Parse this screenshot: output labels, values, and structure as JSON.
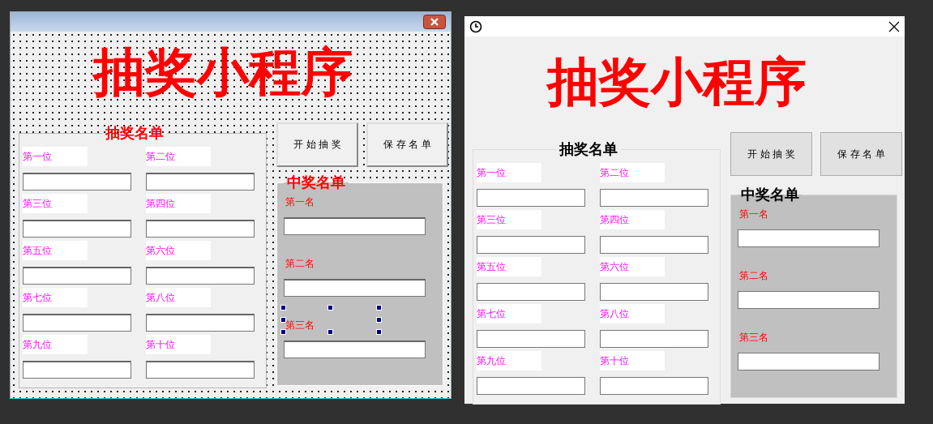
{
  "windows": [
    {
      "kind": "designer",
      "heading": "抽奖小程序",
      "list_frame": {
        "legend": "抽奖名单",
        "labels": [
          "第一位",
          "第二位",
          "第三位",
          "第四位",
          "第五位",
          "第六位",
          "第七位",
          "第八位",
          "第九位",
          "第十位"
        ]
      },
      "buttons": [
        "开 始 抽 奖",
        "保 存 名 单"
      ],
      "winners_frame": {
        "legend": "中奖名单",
        "labels": [
          {
            "text": "第一名",
            "selected": false
          },
          {
            "text": "第二名",
            "selected": false
          },
          {
            "text": "第三名",
            "selected": true
          }
        ]
      }
    },
    {
      "kind": "runtime",
      "heading": "抽奖小程序",
      "list_frame": {
        "legend": "抽奖名单",
        "labels": [
          "第一位",
          "第二位",
          "第三位",
          "第四位",
          "第五位",
          "第六位",
          "第七位",
          "第八位",
          "第九位",
          "第十位"
        ]
      },
      "buttons": [
        "开 始 抽 奖",
        "保 存 名 单"
      ],
      "winners_frame": {
        "legend": "中奖名单",
        "labels": [
          {
            "text": "第一名",
            "selected": false
          },
          {
            "text": "第二名",
            "selected": false
          },
          {
            "text": "第三名",
            "selected": false
          }
        ]
      }
    }
  ]
}
